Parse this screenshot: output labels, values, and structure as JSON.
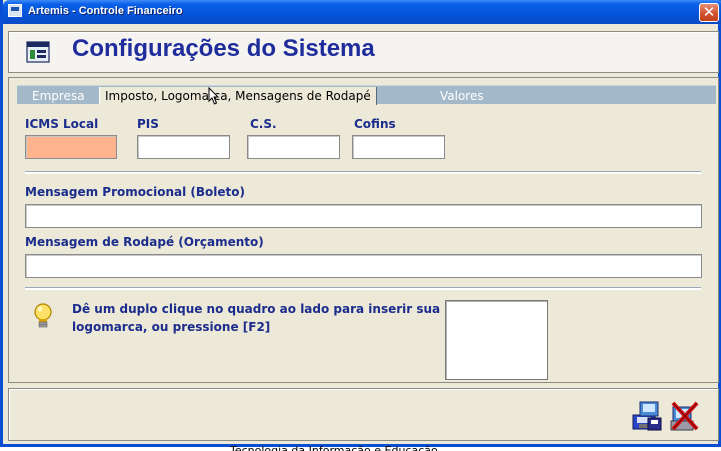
{
  "window": {
    "title": "Artemis - Controle Financeiro",
    "close_label": "✕"
  },
  "header": {
    "title": "Configurações do Sistema",
    "icon": "settings-window-icon"
  },
  "tabs": [
    {
      "label": "Empresa",
      "active": false
    },
    {
      "label": "Imposto, Logomarca, Mensagens de Rodapé",
      "active": true
    },
    {
      "label": "Valores",
      "active": false
    }
  ],
  "taxes": {
    "icms_label": "ICMS Local",
    "icms_value": "",
    "pis_label": "PIS",
    "pis_value": "",
    "cs_label": "C.S.",
    "cs_value": "",
    "cofins_label": "Cofins",
    "cofins_value": ""
  },
  "messages": {
    "promo_label": "Mensagem Promocional (Boleto)",
    "promo_value": "",
    "footer_label": "Mensagem de Rodapé (Orçamento)",
    "footer_value": ""
  },
  "logo": {
    "info_text": "Dê um duplo clique no quadro ao lado para inserir sua logomarca, ou pressione [F2]",
    "icon": "lightbulb-icon"
  },
  "footer": {
    "save_icon": "save-icon",
    "cancel_icon": "cancel-icon"
  },
  "caption": "Tecnologia da Informação e Educação",
  "colors": {
    "title_text": "#1f2c9c",
    "label_text": "#1b2c8c",
    "focused_field": "#ffb48e",
    "tab_strip": "#a3b8c9"
  }
}
